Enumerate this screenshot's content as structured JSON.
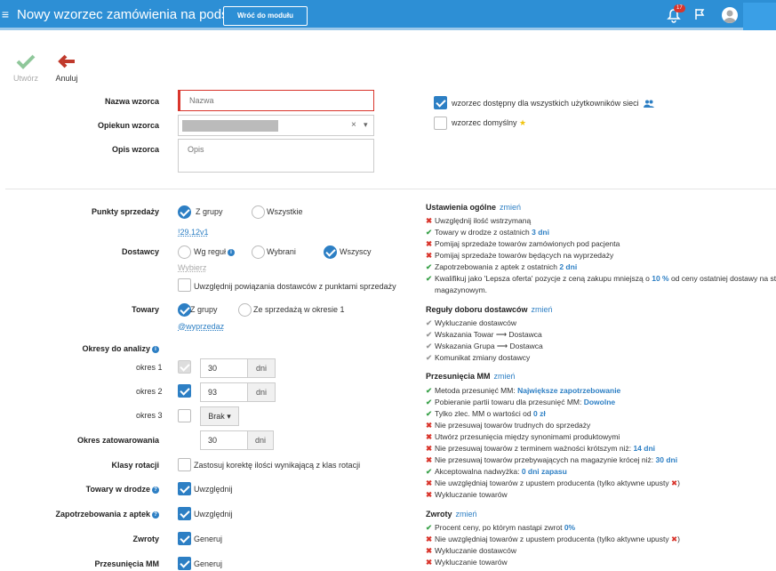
{
  "header": {
    "title": "Nowy wzorzec zamówienia na podstawie",
    "back_button": "Wróć do modułu Wzorce",
    "notif_count": "17"
  },
  "toolbar": {
    "create": "Utwórz",
    "cancel": "Anuluj"
  },
  "form": {
    "name_label": "Nazwa wzorca",
    "name_placeholder": "Nazwa",
    "owner_label": "Opiekun wzorca",
    "owner_clear": "×",
    "owner_caret": "▾",
    "desc_label": "Opis wzorca",
    "desc_placeholder": "Opis",
    "shared_label": "wzorzec dostępny dla wszystkich użytkowników sieci",
    "default_label": "wzorzec domyślny",
    "pos_label": "Punkty sprzedaży",
    "pos_group": "Z grupy",
    "pos_all": "Wszystkie",
    "pos_link": "!29.12v1",
    "suppliers_label": "Dostawcy",
    "sup_rules": "Wg reguł",
    "sup_selected": "Wybrani",
    "sup_all": "Wszyscy",
    "sup_choose": "Wybierz",
    "sup_links": "Uwzględnij powiązania dostawców z punktami sprzedaży",
    "goods_label": "Towary",
    "goods_group": "Z grupy",
    "goods_sold": "Ze sprzedażą w okresie 1",
    "goods_link": "@wyprzedaz",
    "periods_label": "Okresy do analizy",
    "p1_label": "okres 1",
    "p1_value": "30",
    "p1_unit": "dni",
    "p2_label": "okres 2",
    "p2_value": "93",
    "p2_unit": "dni",
    "p3_label": "okres 3",
    "p3_value": "Brak ▾",
    "hold_label": "Okres zatowarowania",
    "hold_value": "30",
    "hold_unit": "dni",
    "rot_label": "Klasy rotacji",
    "rot_text": "Zastosuj korektę ilości wynikającą z klas rotacji",
    "transit_label": "Towary w drodze",
    "transit_text": "Uwzględnij",
    "demand_label": "Zapotrzebowania z aptek",
    "demand_text": "Uwzględnij",
    "returns_label": "Zwroty",
    "returns_text": "Generuj",
    "mm_label": "Przesunięcia MM",
    "mm_text": "Generuj"
  },
  "summary": {
    "change": "zmień",
    "general": {
      "title": "Ustawienia ogólne",
      "items": [
        {
          "ok": false,
          "text": "Uwzględnij ilość wstrzymaną",
          "val": ""
        },
        {
          "ok": true,
          "text": "Towary w drodze z ostatnich ",
          "val": "3 dni"
        },
        {
          "ok": false,
          "text": "Pomijaj sprzedaże towarów zamówionych pod pacjenta",
          "val": ""
        },
        {
          "ok": false,
          "text": "Pomijaj sprzedaże towarów będących na wyprzedaży",
          "val": ""
        },
        {
          "ok": true,
          "text": "Zapotrzebowania z aptek z ostatnich ",
          "val": "2 dni"
        },
        {
          "ok": true,
          "text": "Kwalifikuj jako 'Lepsza oferta' pozycje z ceną zakupu mniejszą o ",
          "val": "10 %",
          "after": " od ceny ostatniej dostawy na stanie"
        },
        {
          "ok": null,
          "text": "magazynowym.",
          "val": ""
        }
      ]
    },
    "rules": {
      "title": "Reguły doboru dostawców",
      "items": [
        "Wykluczanie dostawców",
        "Wskazania Towar ⟶ Dostawca",
        "Wskazania Grupa ⟶ Dostawca",
        "Komunikat zmiany dostawcy"
      ]
    },
    "mm": {
      "title": "Przesunięcia MM",
      "items": [
        {
          "ok": true,
          "text": "Metoda przesunięć MM: ",
          "val": "Największe zapotrzebowanie"
        },
        {
          "ok": true,
          "text": "Pobieranie partii towaru dla przesunięć MM: ",
          "val": "Dowolne"
        },
        {
          "ok": true,
          "text": "Tylko zlec. MM o wartości od ",
          "val": "0 zł"
        },
        {
          "ok": false,
          "text": "Nie przesuwaj towarów trudnych do sprzedaży",
          "val": ""
        },
        {
          "ok": false,
          "text": "Utwórz przesunięcia między synonimami produktowymi",
          "val": ""
        },
        {
          "ok": false,
          "text": "Nie przesuwaj towarów z terminem ważności krótszym niż: ",
          "val": "14 dni"
        },
        {
          "ok": false,
          "text": "Nie przesuwaj towarów przebywających na magazynie krócej niż: ",
          "val": "30 dni"
        },
        {
          "ok": true,
          "text": "Akceptowalna nadwyżka: ",
          "val": "0 dni zapasu"
        },
        {
          "ok": false,
          "text": "Nie uwzględniaj towarów z upustem producenta (tylko aktywne upusty ",
          "val": "",
          "after": "✖)"
        },
        {
          "ok": false,
          "text": "Wykluczanie towarów",
          "val": ""
        }
      ]
    },
    "returns": {
      "title": "Zwroty",
      "items": [
        {
          "ok": true,
          "text": "Procent ceny, po którym nastąpi zwrot ",
          "val": "0%"
        },
        {
          "ok": false,
          "text": "Nie uwzględniaj towarów z upustem producenta (tylko aktywne upusty ",
          "val": "",
          "after": "✖)"
        },
        {
          "ok": false,
          "text": "Wykluczanie dostawców",
          "val": ""
        },
        {
          "ok": false,
          "text": "Wykluczanie towarów",
          "val": ""
        }
      ]
    }
  }
}
